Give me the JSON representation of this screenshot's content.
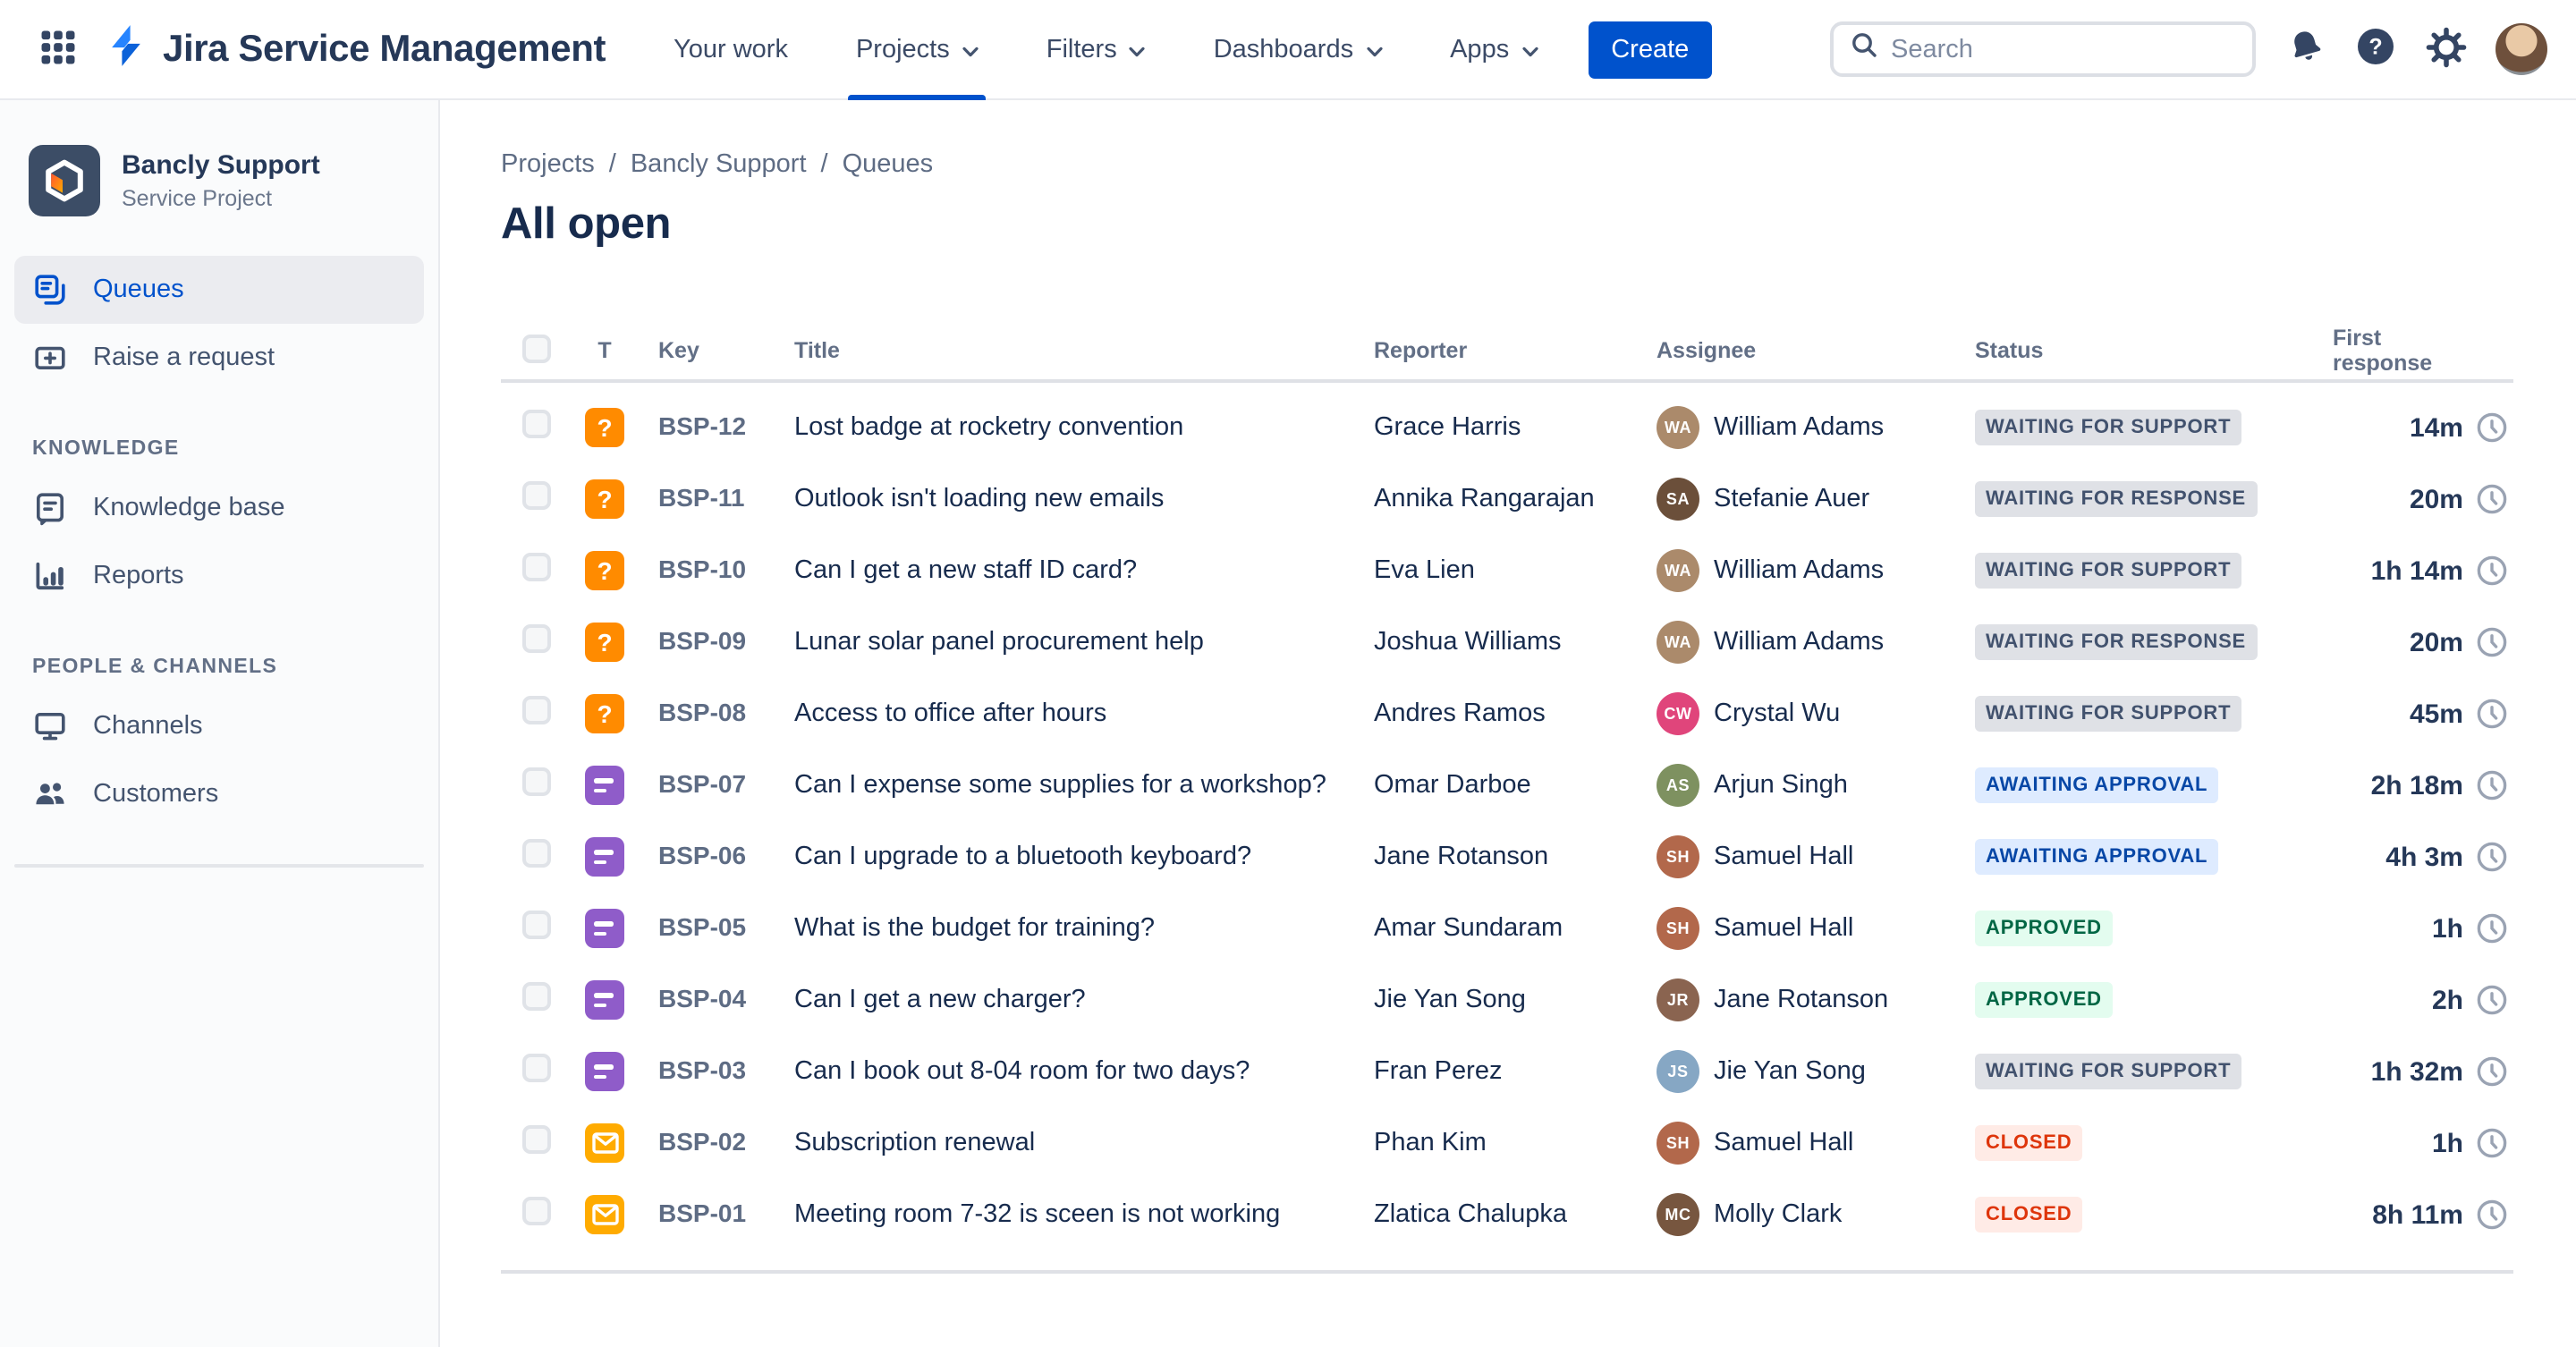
{
  "app": {
    "product_name": "Jira Service Management",
    "nav_items": [
      {
        "label": "Your work",
        "dropdown": false,
        "active": false
      },
      {
        "label": "Projects",
        "dropdown": true,
        "active": true
      },
      {
        "label": "Filters",
        "dropdown": true,
        "active": false
      },
      {
        "label": "Dashboards",
        "dropdown": true,
        "active": false
      },
      {
        "label": "Apps",
        "dropdown": true,
        "active": false
      }
    ],
    "create_button": "Create",
    "search": {
      "placeholder": "Search"
    },
    "icons": {
      "app_switcher": "grid-3x3",
      "logo": "jira-bolt",
      "search": "magnifier",
      "notifications": "bell",
      "help": "question-circle",
      "settings": "gear",
      "profile": "user-avatar"
    }
  },
  "sidebar": {
    "project": {
      "name": "Bancly Support",
      "type": "Service Project"
    },
    "groups": [
      {
        "heading": "",
        "items": [
          {
            "label": "Queues",
            "icon": "queues",
            "selected": true
          },
          {
            "label": "Raise a request",
            "icon": "raise-request",
            "selected": false
          }
        ]
      },
      {
        "heading": "KNOWLEDGE",
        "items": [
          {
            "label": "Knowledge base",
            "icon": "knowledge-base",
            "selected": false
          },
          {
            "label": "Reports",
            "icon": "reports",
            "selected": false
          }
        ]
      },
      {
        "heading": "PEOPLE & CHANNELS",
        "items": [
          {
            "label": "Channels",
            "icon": "channels",
            "selected": false
          },
          {
            "label": "Customers",
            "icon": "customers",
            "selected": false
          }
        ]
      }
    ]
  },
  "main": {
    "breadcrumb": [
      "Projects",
      "Bancly Support",
      "Queues"
    ],
    "breadcrumb_separator": "/",
    "title": "All open",
    "table": {
      "columns": {
        "type": "T",
        "key": "Key",
        "title": "Title",
        "reporter": "Reporter",
        "assignee": "Assignee",
        "status": "Status",
        "first_response": "First response"
      },
      "type_glyphs": {
        "question": "?"
      },
      "rows": [
        {
          "type": "question",
          "key": "BSP-12",
          "title": "Lost badge at rocketry convention",
          "reporter": "Grace Harris",
          "assignee": {
            "name": "William Adams",
            "initials": "WA",
            "color": "#AB8A6B"
          },
          "status": {
            "label": "WAITING FOR SUPPORT",
            "variant": "gray"
          },
          "first_response": "14m"
        },
        {
          "type": "question",
          "key": "BSP-11",
          "title": "Outlook isn't loading new emails",
          "reporter": "Annika Rangarajan",
          "assignee": {
            "name": "Stefanie Auer",
            "initials": "SA",
            "color": "#6B4F3A"
          },
          "status": {
            "label": "WAITING FOR RESPONSE",
            "variant": "gray"
          },
          "first_response": "20m"
        },
        {
          "type": "question",
          "key": "BSP-10",
          "title": "Can I get a new staff ID card?",
          "reporter": "Eva Lien",
          "assignee": {
            "name": "William Adams",
            "initials": "WA",
            "color": "#AB8A6B"
          },
          "status": {
            "label": "WAITING FOR SUPPORT",
            "variant": "gray"
          },
          "first_response": "1h 14m"
        },
        {
          "type": "question",
          "key": "BSP-09",
          "title": "Lunar solar panel procurement help",
          "reporter": "Joshua Williams",
          "assignee": {
            "name": "William Adams",
            "initials": "WA",
            "color": "#AB8A6B"
          },
          "status": {
            "label": "WAITING FOR RESPONSE",
            "variant": "gray"
          },
          "first_response": "20m"
        },
        {
          "type": "question",
          "key": "BSP-08",
          "title": "Access to office after hours",
          "reporter": "Andres Ramos",
          "assignee": {
            "name": "Crystal Wu",
            "initials": "CW",
            "color": "#E0457B"
          },
          "status": {
            "label": "WAITING FOR SUPPORT",
            "variant": "gray"
          },
          "first_response": "45m"
        },
        {
          "type": "request",
          "key": "BSP-07",
          "title": "Can I expense some supplies for a workshop?",
          "reporter": "Omar Darboe",
          "assignee": {
            "name": "Arjun Singh",
            "initials": "AS",
            "color": "#7E9160"
          },
          "status": {
            "label": "AWAITING APPROVAL",
            "variant": "blue"
          },
          "first_response": "2h 18m"
        },
        {
          "type": "request",
          "key": "BSP-06",
          "title": "Can I upgrade to a bluetooth keyboard?",
          "reporter": "Jane Rotanson",
          "assignee": {
            "name": "Samuel Hall",
            "initials": "SH",
            "color": "#B2684B"
          },
          "status": {
            "label": "AWAITING APPROVAL",
            "variant": "blue"
          },
          "first_response": "4h 3m"
        },
        {
          "type": "request",
          "key": "BSP-05",
          "title": "What is the budget for training?",
          "reporter": "Amar Sundaram",
          "assignee": {
            "name": "Samuel Hall",
            "initials": "SH",
            "color": "#B2684B"
          },
          "status": {
            "label": "APPROVED",
            "variant": "green"
          },
          "first_response": "1h"
        },
        {
          "type": "request",
          "key": "BSP-04",
          "title": "Can I get a new charger?",
          "reporter": "Jie Yan Song",
          "assignee": {
            "name": "Jane Rotanson",
            "initials": "JR",
            "color": "#8A6450"
          },
          "status": {
            "label": "APPROVED",
            "variant": "green"
          },
          "first_response": "2h"
        },
        {
          "type": "request",
          "key": "BSP-03",
          "title": "Can I book out 8-04 room for two days?",
          "reporter": "Fran Perez",
          "assignee": {
            "name": "Jie Yan Song",
            "initials": "JS",
            "color": "#86A7C4"
          },
          "status": {
            "label": "WAITING FOR SUPPORT",
            "variant": "gray"
          },
          "first_response": "1h 32m"
        },
        {
          "type": "email",
          "key": "BSP-02",
          "title": "Subscription renewal",
          "reporter": "Phan Kim",
          "assignee": {
            "name": "Samuel Hall",
            "initials": "SH",
            "color": "#B2684B"
          },
          "status": {
            "label": "CLOSED",
            "variant": "red"
          },
          "first_response": "1h"
        },
        {
          "type": "email",
          "key": "BSP-01",
          "title": "Meeting room 7-32 is sceen is not working",
          "reporter": "Zlatica Chalupka",
          "assignee": {
            "name": "Molly Clark",
            "initials": "MC",
            "color": "#77563F"
          },
          "status": {
            "label": "CLOSED",
            "variant": "red"
          },
          "first_response": "8h 11m"
        }
      ]
    }
  },
  "colors": {
    "accent_blue": "#0052CC",
    "nav_text": "#3B4A66",
    "sidebar_bg": "#FAFBFC",
    "type_question": "#FF8B00",
    "type_request": "#8F5CC9",
    "type_email": "#FFAB00",
    "status_variants": {
      "gray": {
        "bg": "#DFE1E6",
        "text": "#42526E"
      },
      "blue": {
        "bg": "#DEEBFF",
        "text": "#0747A6"
      },
      "green": {
        "bg": "#E3FCEF",
        "text": "#006644"
      },
      "red": {
        "bg": "#FFEBE6",
        "text": "#DE350B"
      }
    }
  }
}
